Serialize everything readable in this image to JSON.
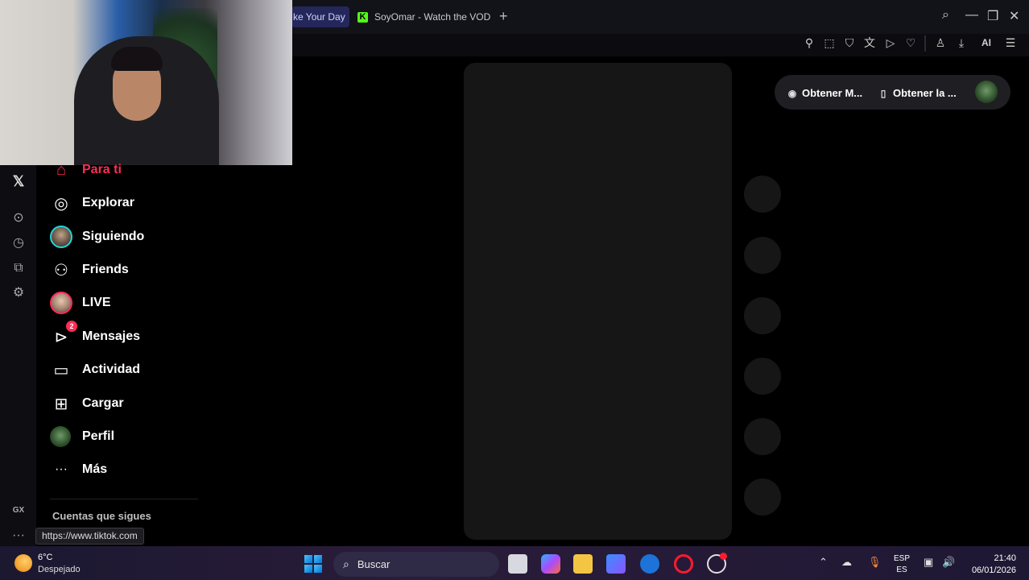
{
  "browser": {
    "tabs": [
      {
        "label": "ke Your Day",
        "active": true
      },
      {
        "label": "SoyOmar - Watch the VOD",
        "icon": "kick-icon",
        "active": false
      }
    ],
    "new_tab_symbol": "+",
    "toolbar_right_label": "AI"
  },
  "tiktok": {
    "nav": [
      {
        "label": "Para ti",
        "icon": "home-icon"
      },
      {
        "label": "Explorar",
        "icon": "compass-icon"
      },
      {
        "label": "Siguiendo",
        "icon": "avatar"
      },
      {
        "label": "Friends",
        "icon": "friends-icon"
      },
      {
        "label": "LIVE",
        "icon": "avatar"
      },
      {
        "label": "Mensajes",
        "icon": "send-icon",
        "badge": "2"
      },
      {
        "label": "Actividad",
        "icon": "activity-icon"
      },
      {
        "label": "Cargar",
        "icon": "upload-icon"
      },
      {
        "label": "Perfil",
        "icon": "avatar"
      },
      {
        "label": "Más",
        "icon": "more-icon"
      }
    ],
    "following_title": "Cuentas que sigues",
    "header_pills": [
      {
        "label": "Obtener M...",
        "icon": "coin-icon"
      },
      {
        "label": "Obtener la ...",
        "icon": "phone-icon"
      }
    ]
  },
  "status_url": "https://www.tiktok.com",
  "opera_sidebar": {
    "gx_label": "GX",
    "more_label": "···"
  },
  "taskbar": {
    "weather": {
      "temp": "6°C",
      "desc": "Despejado"
    },
    "search_label": "Buscar",
    "lang": {
      "line1": "ESP",
      "line2": "ES"
    },
    "time": "21:40",
    "date": "06/01/2026"
  },
  "colors": {
    "accent_red": "#fe2c55",
    "accent_cyan": "#20d5d8",
    "kick_green": "#53fc18"
  }
}
